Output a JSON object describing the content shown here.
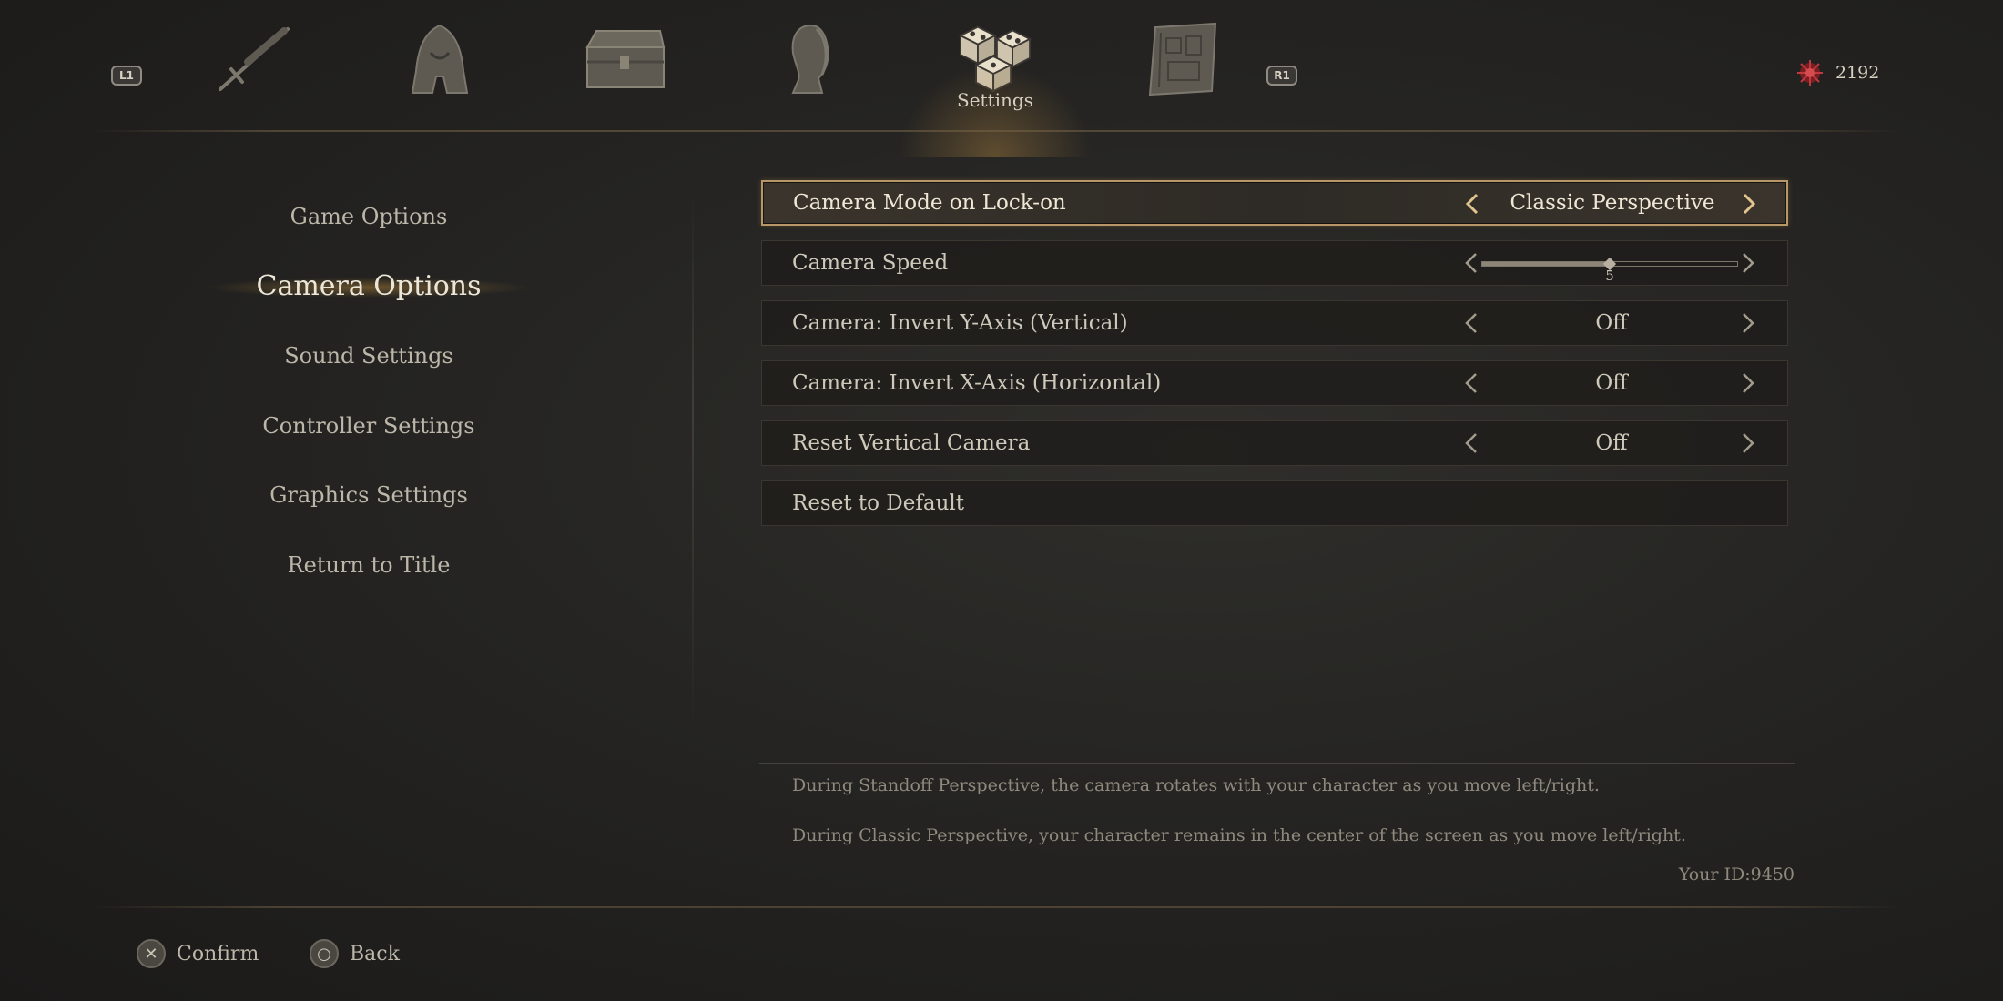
{
  "header": {
    "left_shoulder": "L1",
    "right_shoulder": "R1",
    "tabs": [
      {
        "icon": "sword-icon",
        "label": ""
      },
      {
        "icon": "hooded-armor-icon",
        "label": ""
      },
      {
        "icon": "chest-icon",
        "label": ""
      },
      {
        "icon": "puppet-head-icon",
        "label": ""
      },
      {
        "icon": "settings-cubes-icon",
        "label": "Settings"
      },
      {
        "icon": "map-scroll-icon",
        "label": ""
      }
    ],
    "currency": {
      "icon": "ergo-icon",
      "value": "2192"
    }
  },
  "sidebar": {
    "items": [
      {
        "label": "Game Options"
      },
      {
        "label": "Camera Options"
      },
      {
        "label": "Sound Settings"
      },
      {
        "label": "Controller Settings"
      },
      {
        "label": "Graphics Settings"
      },
      {
        "label": "Return to Title"
      }
    ],
    "active_index": 1
  },
  "settings": {
    "rows": [
      {
        "label": "Camera Mode on Lock-on",
        "value": "Classic Perspective"
      },
      {
        "label": "Camera Speed",
        "value": "5",
        "level": 0.5
      },
      {
        "label": "Camera: Invert Y-Axis (Vertical)",
        "value": "Off"
      },
      {
        "label": "Camera: Invert X-Axis (Horizontal)",
        "value": "Off"
      },
      {
        "label": "Reset Vertical Camera",
        "value": "Off"
      },
      {
        "label": "Reset to Default"
      }
    ],
    "selected_index": 0
  },
  "description": {
    "line1": "During Standoff Perspective, the camera rotates with your character as you move left/right.",
    "line2": "During Classic Perspective, your character remains in the center of the screen as you move left/right."
  },
  "user_id": "Your ID:9450",
  "footer": {
    "confirm": {
      "icon": "cross-button-icon",
      "glyph": "✕",
      "label": "Confirm"
    },
    "back": {
      "icon": "circle-button-icon",
      "glyph": "○",
      "label": "Back"
    }
  },
  "colors": {
    "accent": "#b79667",
    "background": "#252422",
    "text": "#cfc9bb"
  }
}
